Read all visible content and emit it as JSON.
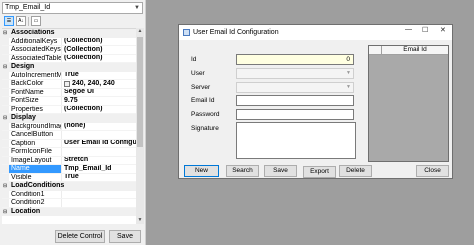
{
  "object_selector": {
    "value": "Tmp_Email_Id"
  },
  "property_grid": {
    "categories": [
      {
        "label": "Associations",
        "expander": "⊟",
        "props": [
          {
            "name": "AdditionalKeys",
            "value": "(Collection)"
          },
          {
            "name": "AssociatedKeys",
            "value": "(Collection)"
          },
          {
            "name": "AssociatedTables",
            "value": "(Collection)"
          }
        ]
      },
      {
        "label": "Design",
        "expander": "⊟",
        "props": [
          {
            "name": "AutoIncrementMultiInst",
            "value": "True"
          },
          {
            "name": "BackColor",
            "value": "240, 240, 240",
            "swatch": "#f0f0f0"
          },
          {
            "name": "FontName",
            "value": "Segoe UI"
          },
          {
            "name": "FontSize",
            "value": "9.75"
          },
          {
            "name": "Properties",
            "value": "(Collection)"
          }
        ]
      },
      {
        "label": "Display",
        "expander": "⊟",
        "props": [
          {
            "name": "BackgroundImage",
            "value": "(none)"
          },
          {
            "name": "CancelButton",
            "value": ""
          },
          {
            "name": "Caption",
            "value": "User Email Id Configuration"
          },
          {
            "name": "FormIconFile",
            "value": ""
          },
          {
            "name": "ImageLayout",
            "value": "Stretch"
          },
          {
            "name": "Name",
            "value": "Tmp_Email_Id",
            "selected": true
          },
          {
            "name": "Visible",
            "value": "True"
          }
        ]
      },
      {
        "label": "LoadConditions",
        "expander": "⊟",
        "props": [
          {
            "name": "Condition1",
            "value": ""
          },
          {
            "name": "Condition2",
            "value": ""
          }
        ]
      },
      {
        "label": "Location",
        "expander": "⊟",
        "props": []
      }
    ]
  },
  "panel_buttons": {
    "delete_control": "Delete Control",
    "save": "Save"
  },
  "form": {
    "title": "User Email Id Configuration",
    "titlebar_controls": {
      "minimize": "—",
      "maximize": "☐",
      "close": "✕"
    },
    "labels": {
      "id": "Id",
      "user": "User",
      "server": "Server",
      "email_id": "Email Id",
      "password": "Password",
      "signature": "Signature"
    },
    "id_value": "0",
    "grid_header": "Email Id",
    "buttons": {
      "new": "New",
      "search": "Search",
      "save": "Save",
      "export": "Export",
      "delete": "Delete",
      "close": "Close"
    }
  },
  "colors": {
    "canvas": "#9e9e9e",
    "panel": "#f0f0f0",
    "selection": "#3399ff",
    "id_field": "#ffffe1"
  }
}
